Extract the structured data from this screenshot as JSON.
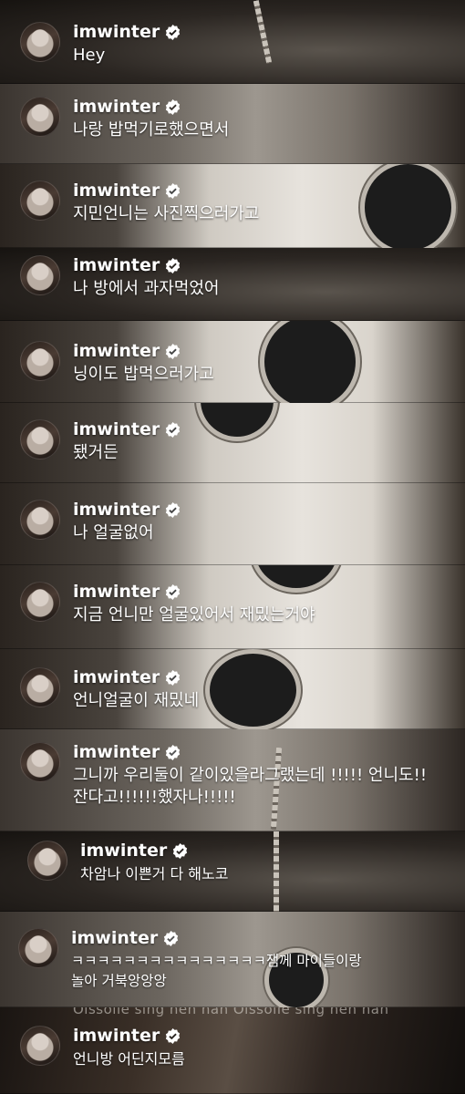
{
  "username": "imwinter",
  "verified_icon": "verified-check-icon",
  "messages": [
    {
      "text": "Hey"
    },
    {
      "text": "나랑 밥먹기로했으면서"
    },
    {
      "text": "지민언니는 사진찍으러가고"
    },
    {
      "text": "나 방에서 과자먹었어"
    },
    {
      "text": "닝이도 밥먹으러가고"
    },
    {
      "text": "됐거든"
    },
    {
      "text": "나 얼굴없어"
    },
    {
      "text": "지금 언니만 얼굴있어서 재밌는거야"
    },
    {
      "text": "언니얼굴이 재밌네"
    },
    {
      "text": "그니까 우리둘이 같이있을라그랬는데 !!!!! 언니도!!\n잔다고!!!!!!했자나!!!!!"
    },
    {
      "text": "차암나 이쁜거 다 해노코"
    },
    {
      "text": "ㅋㅋㅋㅋㅋㅋㅋㅋㅋㅋㅋㅋㅋㅋㅋ잼께 마이들이랑\n놀아 거북앙앙앙"
    },
    {
      "text": "언니방 어딘지모름"
    }
  ],
  "background_overlay_text": {
    "strip13": "Oissolle sing nen nan Oissolle sing nen nan"
  },
  "colors": {
    "text": "#ffffff",
    "badge": "#ffffff"
  }
}
